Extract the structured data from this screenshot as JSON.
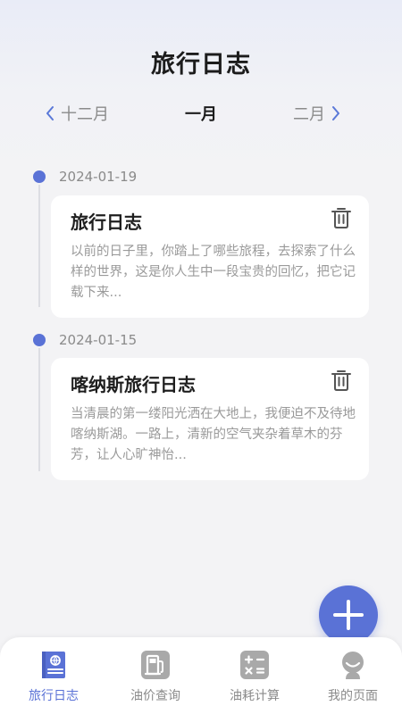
{
  "header": {
    "title": "旅行日志"
  },
  "month_nav": {
    "prev": "十二月",
    "current": "一月",
    "next": "二月"
  },
  "entries": [
    {
      "date": "2024-01-19",
      "title": "旅行日志",
      "body": "以前的日子里，你踏上了哪些旅程，去探索了什么样的世界，这是你人生中一段宝贵的回忆，把它记载下来..."
    },
    {
      "date": "2024-01-15",
      "title": "喀纳斯旅行日志",
      "body": "当清晨的第一缕阳光洒在大地上，我便迫不及待地喀纳斯湖。一路上，清新的空气夹杂着草木的芬芳，让人心旷神怡..."
    }
  ],
  "tabs": [
    {
      "label": "旅行日志",
      "icon": "travel-log-icon",
      "active": true
    },
    {
      "label": "油价查询",
      "icon": "fuel-pump-icon",
      "active": false
    },
    {
      "label": "油耗计算",
      "icon": "calculator-icon",
      "active": false
    },
    {
      "label": "我的页面",
      "icon": "profile-icon",
      "active": false
    }
  ],
  "colors": {
    "accent": "#5a72d6",
    "background": "#f3f3f5",
    "card": "#ffffff",
    "muted": "#8a8a8a"
  }
}
